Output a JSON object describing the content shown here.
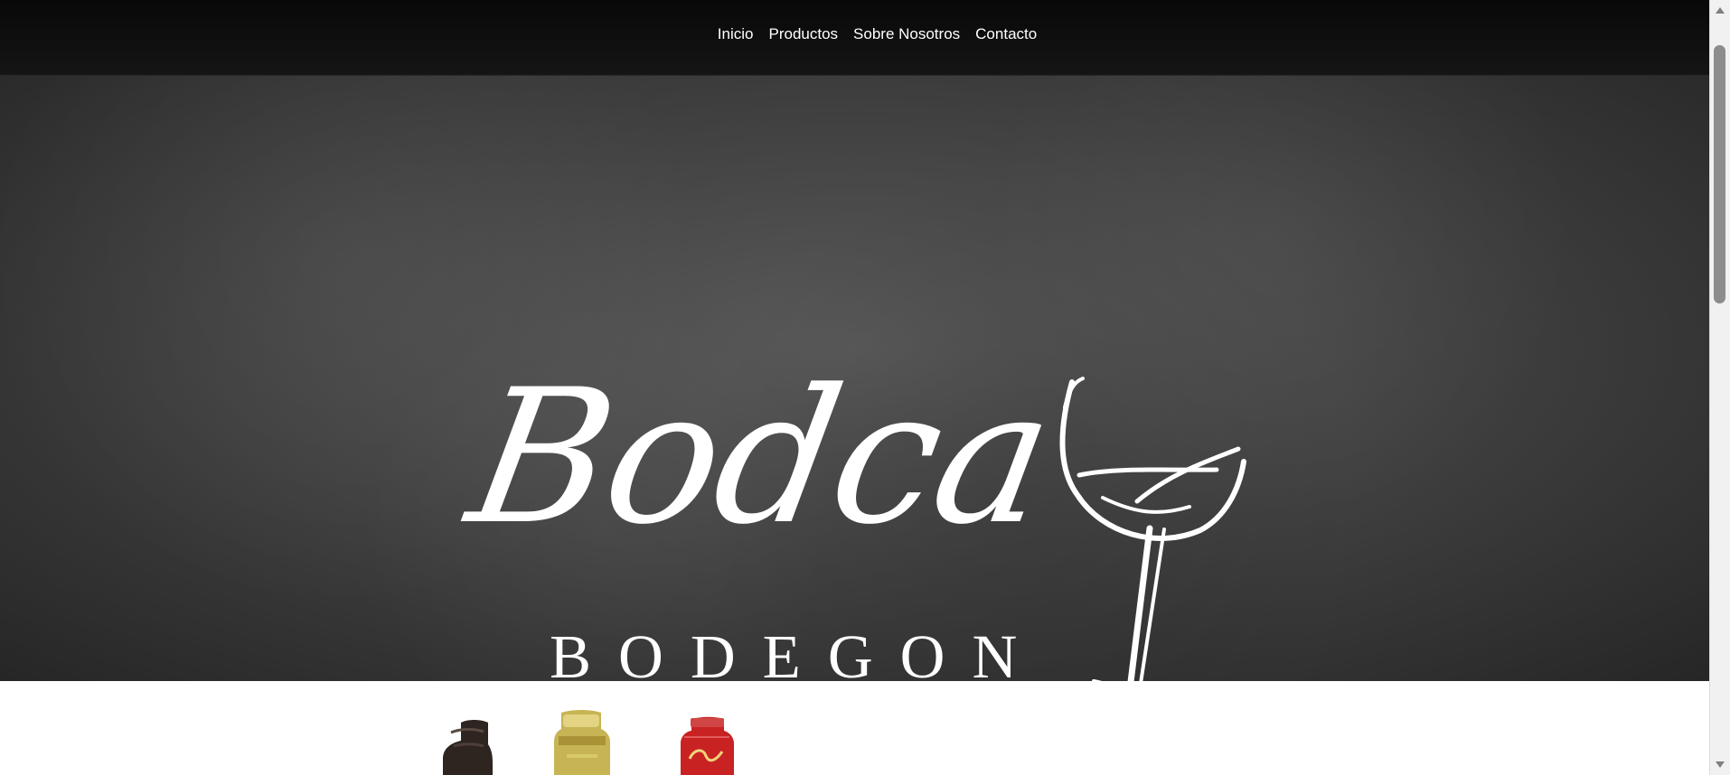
{
  "nav": {
    "items": [
      {
        "label": "Inicio"
      },
      {
        "label": "Productos"
      },
      {
        "label": "Sobre Nosotros"
      },
      {
        "label": "Contacto"
      }
    ]
  },
  "hero": {
    "logo_script": "Bodca",
    "logo_subtitle": "BODEGON",
    "logo_icon": "wine-glass-icon"
  },
  "colors": {
    "navbar": "#111111",
    "hero_bg": "#3f3f3f",
    "logo": "#ffffff",
    "page_bg": "#ffffff"
  }
}
